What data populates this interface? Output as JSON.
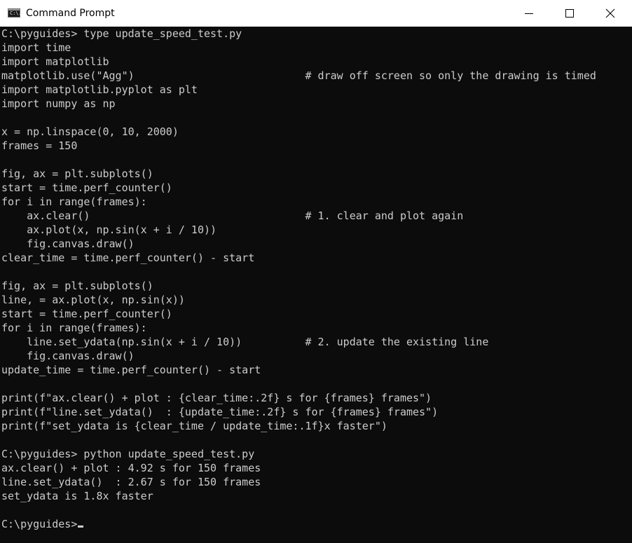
{
  "window": {
    "title": "Command Prompt",
    "icon": "cmd-app-icon",
    "icon_glyph": "C:\\.",
    "controls": [
      "minimize-icon",
      "maximize-icon",
      "close-icon"
    ]
  },
  "console": {
    "lines": [
      "C:\\pyguides> type update_speed_test.py",
      "import time",
      "import matplotlib",
      "matplotlib.use(\"Agg\")                           # draw off screen so only the drawing is timed",
      "import matplotlib.pyplot as plt",
      "import numpy as np",
      "",
      "x = np.linspace(0, 10, 2000)",
      "frames = 150",
      "",
      "fig, ax = plt.subplots()",
      "start = time.perf_counter()",
      "for i in range(frames):",
      "    ax.clear()                                  # 1. clear and plot again",
      "    ax.plot(x, np.sin(x + i / 10))",
      "    fig.canvas.draw()",
      "clear_time = time.perf_counter() - start",
      "",
      "fig, ax = plt.subplots()",
      "line, = ax.plot(x, np.sin(x))",
      "start = time.perf_counter()",
      "for i in range(frames):",
      "    line.set_ydata(np.sin(x + i / 10))          # 2. update the existing line",
      "    fig.canvas.draw()",
      "update_time = time.perf_counter() - start",
      "",
      "print(f\"ax.clear() + plot : {clear_time:.2f} s for {frames} frames\")",
      "print(f\"line.set_ydata()  : {update_time:.2f} s for {frames} frames\")",
      "print(f\"set_ydata is {clear_time / update_time:.1f}x faster\")",
      "",
      "C:\\pyguides> python update_speed_test.py",
      "ax.clear() + plot : 4.92 s for 150 frames",
      "line.set_ydata()  : 2.67 s for 150 frames",
      "set_ydata is 1.8x faster",
      ""
    ],
    "prompt": "C:\\pyguides>"
  },
  "colors": {
    "background": "#0c0c0c",
    "foreground": "#cccccc",
    "titlebar": "#ffffff"
  }
}
